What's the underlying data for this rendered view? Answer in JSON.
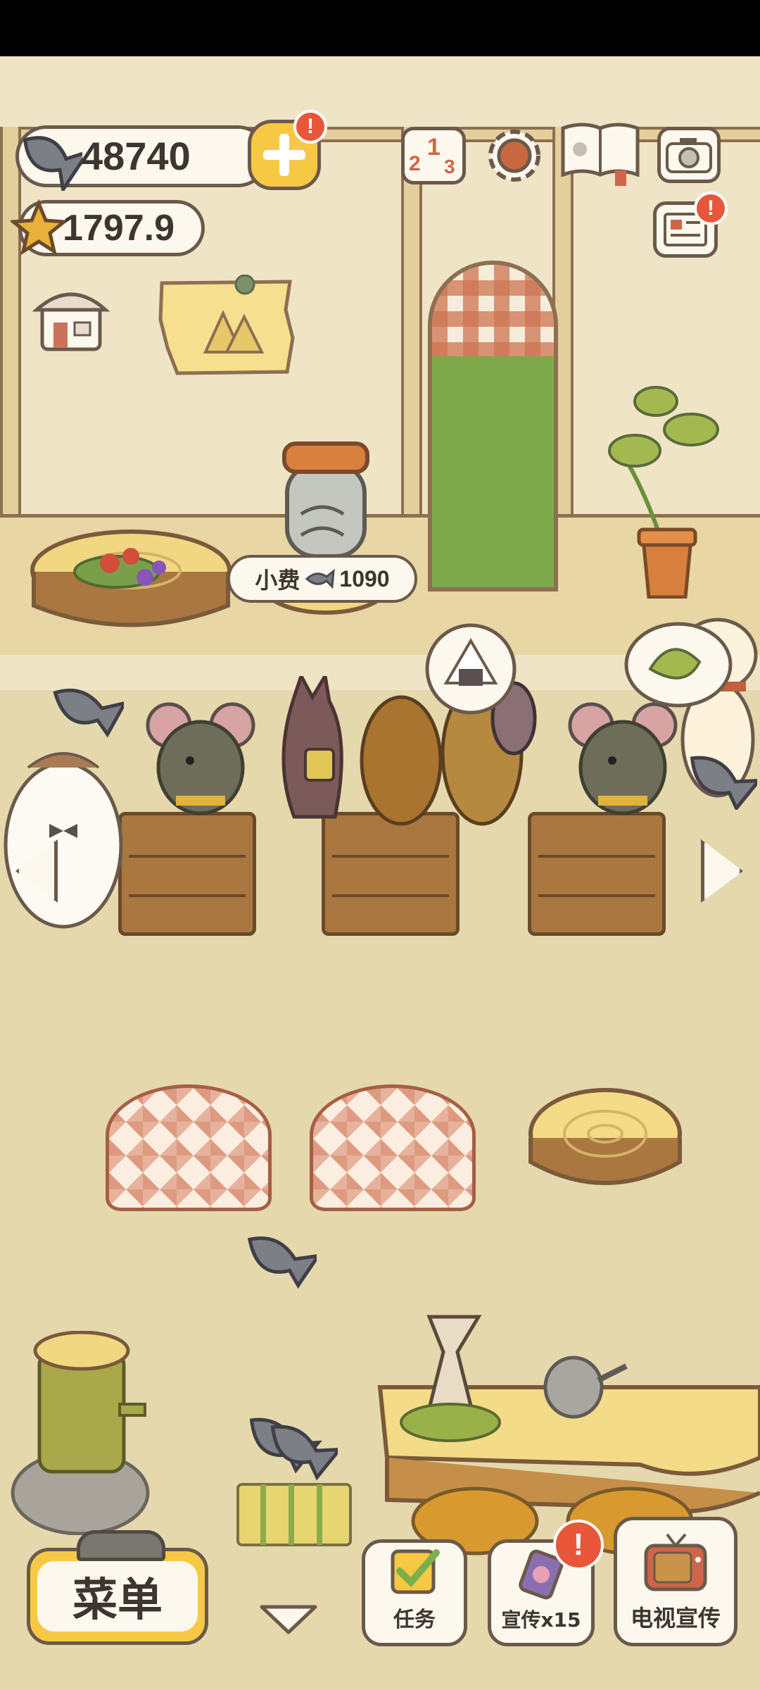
{
  "hud": {
    "fish_count": "48740",
    "star_count": "1797.9",
    "badge_mark": "!"
  },
  "speech": {
    "tip_label": "小费",
    "tip_amount": "1090"
  },
  "bottom_bar": {
    "menu_label": "菜单",
    "tasks_label": "任务",
    "promote_label": "宣传x15",
    "tv_promote_label": "电视宣传"
  },
  "colors": {
    "accent_yellow": "#f7c843",
    "badge_red": "#e8573a",
    "outline": "#6b5a4b",
    "wall": "#efe5c6",
    "floor": "#e6d8ad"
  },
  "icons": [
    "fish-icon",
    "plus-icon",
    "star-icon",
    "leaderboard-icon",
    "gear-icon",
    "recipe-book-icon",
    "camera-icon",
    "newspaper-icon",
    "shop-icon",
    "checklist-icon",
    "promo-icon",
    "tv-icon",
    "chevron-left-icon",
    "chevron-right-icon",
    "chevron-down-icon"
  ]
}
